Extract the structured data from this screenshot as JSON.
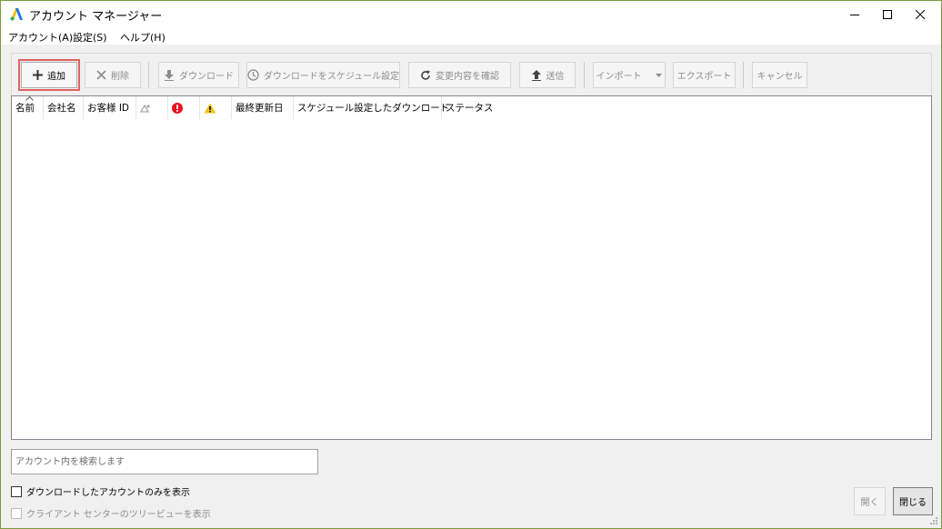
{
  "window": {
    "title": "アカウント マネージャー",
    "controls": {
      "minimize_icon": "minimize-icon",
      "maximize_icon": "maximize-icon",
      "close_icon": "close-icon"
    }
  },
  "menu": {
    "items": [
      "アカウント(A)",
      "設定(S)",
      "ヘルプ(H)"
    ]
  },
  "toolbar": {
    "add": "追加",
    "delete": "削除",
    "download": "ダウンロード",
    "schedule": "ダウンロードをスケジュール設定",
    "review": "変更内容を確認",
    "send": "送信",
    "import": "インポート",
    "export": "エクスポート",
    "cancel": "キャンセル"
  },
  "grid": {
    "columns": [
      "名前",
      "会社名",
      "お客様 ID",
      "",
      "",
      "",
      "最終更新日",
      "スケジュール設定したダウンロード",
      "ステータス"
    ],
    "rows": []
  },
  "search": {
    "placeholder": "アカウント内を検索します"
  },
  "options": {
    "downloaded_only": "ダウンロードしたアカウントのみを表示",
    "client_center_tree": "クライアント センターのツリービューを表示"
  },
  "buttons": {
    "open": "開く",
    "close": "閉じる"
  },
  "colors": {
    "accent_focus": "#e06262",
    "error": "#e81123",
    "warning": "#f2c40f",
    "logo_blue": "#1a73e8",
    "logo_yellow": "#fbbc04"
  }
}
